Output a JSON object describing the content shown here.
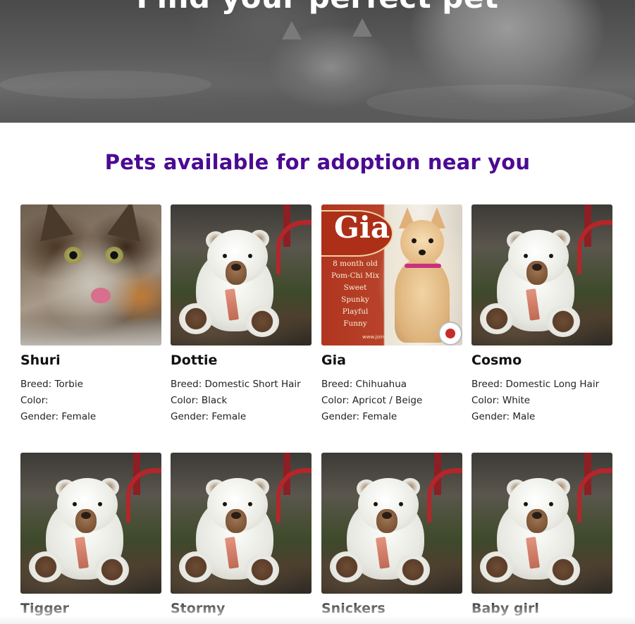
{
  "hero": {
    "title": "Find your perfect pet"
  },
  "section": {
    "title": "Pets available for adoption near you"
  },
  "gia_photo": {
    "big_text": "Gia",
    "lines": [
      "8 month old",
      "Pom-Chi Mix",
      "Sweet",
      "Spunky",
      "Playful",
      "Funny"
    ],
    "url_text": "www.jointhescars.org"
  },
  "pets": [
    {
      "name": "Shuri",
      "breed": "Breed: Torbie",
      "color": "Color:",
      "gender": "Gender: Female",
      "photo": "cat-photo"
    },
    {
      "name": "Dottie",
      "breed": "Breed: Domestic Short Hair",
      "color": "Color: Black",
      "gender": "Gender: Female",
      "photo": "teddy-bear-placeholder"
    },
    {
      "name": "Gia",
      "breed": "Breed: Chihuahua",
      "color": "Color: Apricot / Beige",
      "gender": "Gender: Female",
      "photo": "dog-flyer-photo"
    },
    {
      "name": "Cosmo",
      "breed": "Breed: Domestic Long Hair",
      "color": "Color: White",
      "gender": "Gender: Male",
      "photo": "teddy-bear-placeholder"
    },
    {
      "name": "Tigger",
      "photo": "teddy-bear-placeholder"
    },
    {
      "name": "Stormy",
      "photo": "teddy-bear-placeholder"
    },
    {
      "name": "Snickers",
      "photo": "teddy-bear-placeholder"
    },
    {
      "name": "Baby girl",
      "photo": "teddy-bear-placeholder"
    }
  ],
  "colors": {
    "section_title": "#4b0a93",
    "text": "#1e1e1e"
  }
}
